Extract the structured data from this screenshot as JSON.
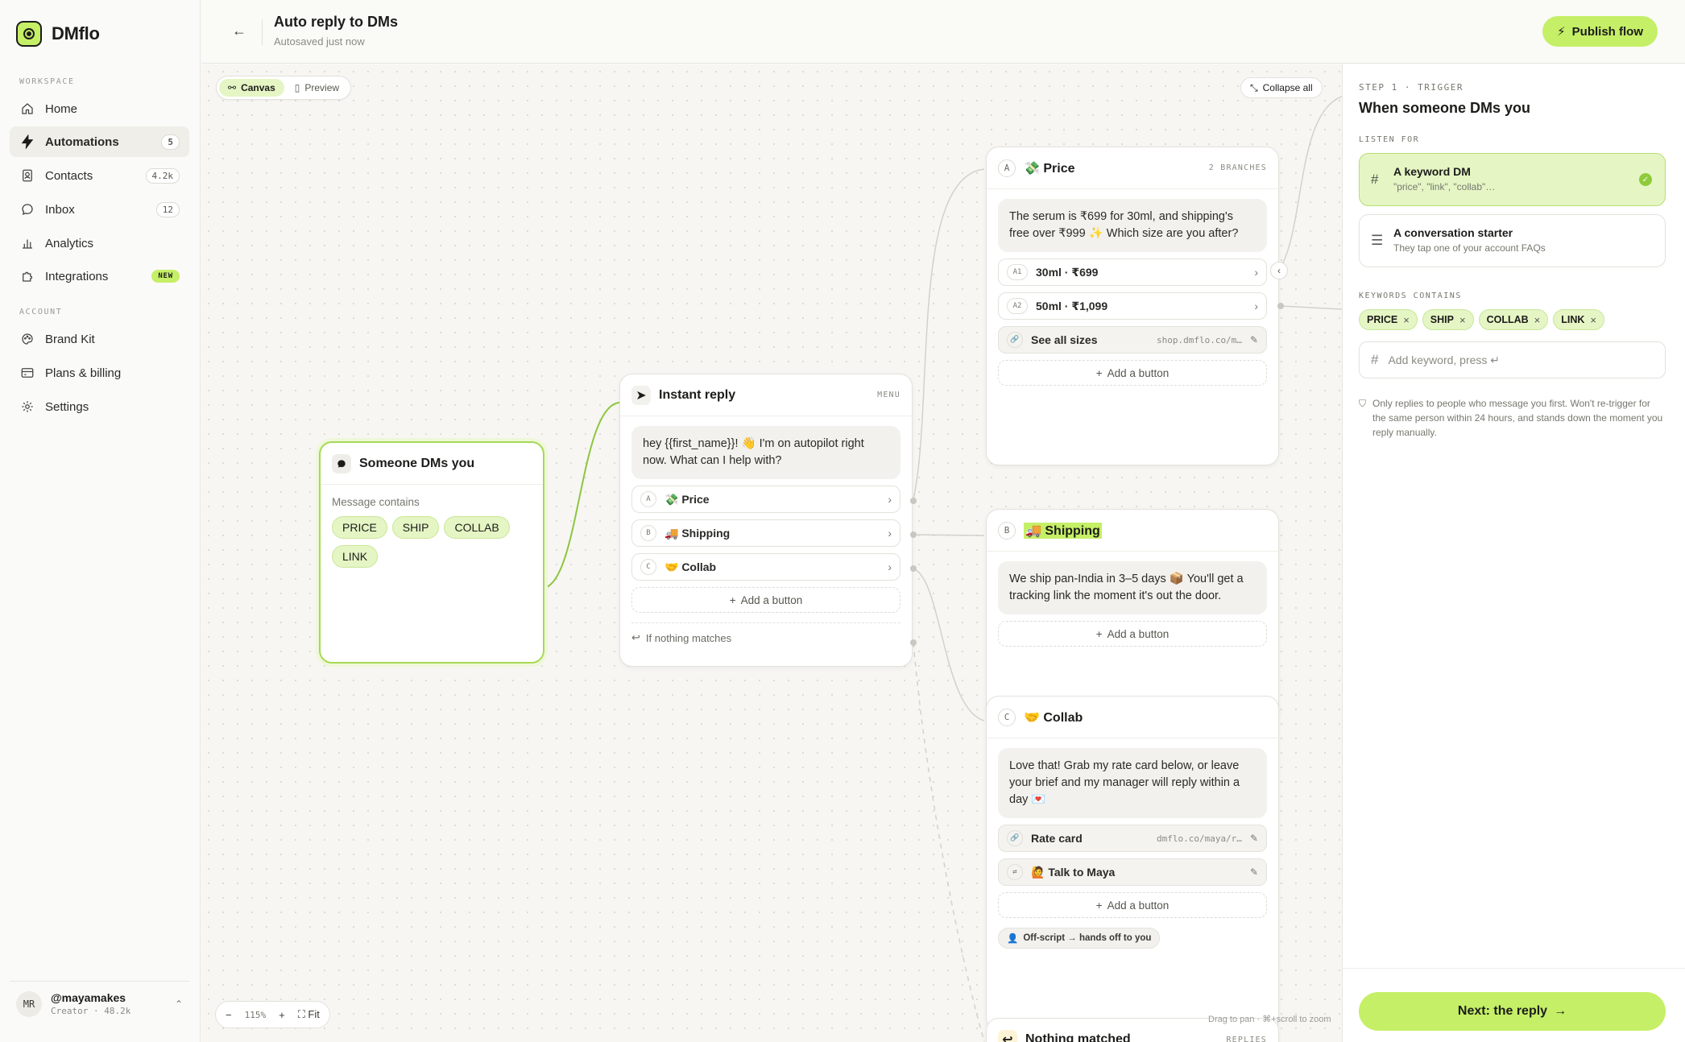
{
  "app": {
    "name": "DMflo"
  },
  "sidebar": {
    "workspace_label": "WORKSPACE",
    "account_label": "ACCOUNT",
    "workspace_items": [
      {
        "label": "Home",
        "icon": "home-icon",
        "badge": ""
      },
      {
        "label": "Automations",
        "icon": "lightning-icon",
        "badge": "5"
      },
      {
        "label": "Contacts",
        "icon": "contacts-icon",
        "badge": "4.2k"
      },
      {
        "label": "Inbox",
        "icon": "chat-icon",
        "badge": "12"
      },
      {
        "label": "Analytics",
        "icon": "bar-chart-icon",
        "badge": ""
      },
      {
        "label": "Integrations",
        "icon": "puzzle-icon",
        "badge": "NEW"
      }
    ],
    "account_items": [
      {
        "label": "Brand Kit",
        "icon": "palette-icon"
      },
      {
        "label": "Plans & billing",
        "icon": "card-icon"
      },
      {
        "label": "Settings",
        "icon": "gear-icon"
      }
    ],
    "user": {
      "initials": "MR",
      "handle": "@mayamakes",
      "meta": "Creator · 48.2k"
    }
  },
  "header": {
    "title": "Auto reply to DMs",
    "subtitle": "Autosaved just now",
    "publish_label": "Publish flow"
  },
  "canvas": {
    "view_tabs": [
      "Canvas",
      "Preview"
    ],
    "collapse_label": "Collapse all",
    "zoom": "115%",
    "fit_label": "Fit",
    "hint": "Drag to pan · ⌘+scroll to zoom",
    "trigger_node": {
      "title": "Someone DMs you",
      "label": "Message contains",
      "keywords": [
        "PRICE",
        "SHIP",
        "COLLAB",
        "LINK"
      ]
    },
    "reply_node": {
      "title": "Instant reply",
      "tag": "MENU",
      "message": "hey {{first_name}}! 👋 I'm on autopilot right now. What can I help with?",
      "options": [
        {
          "key": "A",
          "label": "💸 Price"
        },
        {
          "key": "B",
          "label": "🚚 Shipping"
        },
        {
          "key": "C",
          "label": "🤝 Collab"
        }
      ],
      "add_label": "Add a button",
      "fallback_label": "If nothing matches"
    },
    "price_node": {
      "key": "A",
      "title": "💸 Price",
      "tag": "2 BRANCHES",
      "message": "The serum is ₹699 for 30ml, and shipping's free over ₹999 ✨ Which size are you after?",
      "options": [
        {
          "key": "A1",
          "label": "30ml · ₹699"
        },
        {
          "key": "A2",
          "label": "50ml · ₹1,099"
        }
      ],
      "link": {
        "label": "See all sizes",
        "url": "shop.dmflo.co/m…"
      },
      "add_label": "Add a button"
    },
    "shipping_node": {
      "key": "B",
      "title": "🚚 Shipping",
      "message": "We ship pan-India in 3–5 days 📦 You'll get a tracking link the moment it's out the door.",
      "add_label": "Add a button"
    },
    "collab_node": {
      "key": "C",
      "title": "🤝 Collab",
      "message": "Love that! Grab my rate card below, or leave your brief and my manager will reply within a day 💌",
      "link": {
        "label": "Rate card",
        "url": "dmflo.co/maya/r…"
      },
      "handoff_option": {
        "label": "🙋 Talk to Maya"
      },
      "add_label": "Add a button",
      "handoff_label": "Off-script → hands off to you"
    },
    "nothing_node": {
      "title": "Nothing matched",
      "tag": "REPLIES"
    }
  },
  "panel": {
    "eyebrow": "STEP 1 · TRIGGER",
    "title": "When someone DMs you",
    "listen_label": "LISTEN FOR",
    "choices": [
      {
        "title": "A keyword DM",
        "sub": "\"price\", \"link\", \"collab\"…"
      },
      {
        "title": "A conversation starter",
        "sub": "They tap one of your account FAQs"
      }
    ],
    "keywords_label": "KEYWORDS CONTAINS",
    "keywords": [
      "PRICE",
      "SHIP",
      "COLLAB",
      "LINK"
    ],
    "keyword_placeholder": "Add keyword, press ↵",
    "note": "Only replies to people who message you first. Won't re-trigger for the same person within 24 hours, and stands down the moment you reply manually.",
    "next_label": "Next:  the reply"
  },
  "colors": {
    "accent": "#c5ef66",
    "accent_soft": "#e5f5c4",
    "wire_active": "#8cc63f"
  }
}
